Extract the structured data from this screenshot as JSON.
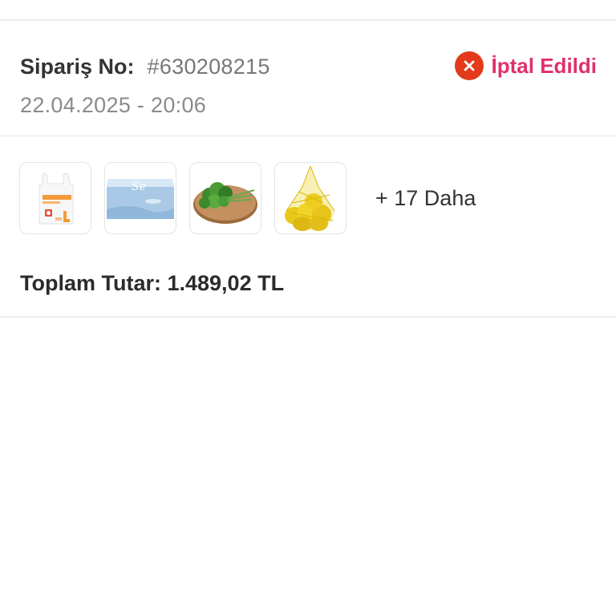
{
  "order": {
    "label": "Sipariş No:",
    "number": "#630208215",
    "date": "22.04.2025 - 20:06"
  },
  "status": {
    "icon": "close-circle-icon",
    "text": "İptal Edildi",
    "icon_color": "#e23a1a",
    "text_color": "#e0306b"
  },
  "products": {
    "items": [
      {
        "name": "shopping-bag",
        "icon": "bag-image"
      },
      {
        "name": "tissue-box",
        "icon": "tissue-image"
      },
      {
        "name": "parsley-bunch",
        "icon": "parsley-image"
      },
      {
        "name": "lemons-net",
        "icon": "lemon-image"
      }
    ],
    "more_text": "+ 17 Daha"
  },
  "total": {
    "text": "Toplam Tutar: 1.489,02 TL"
  }
}
